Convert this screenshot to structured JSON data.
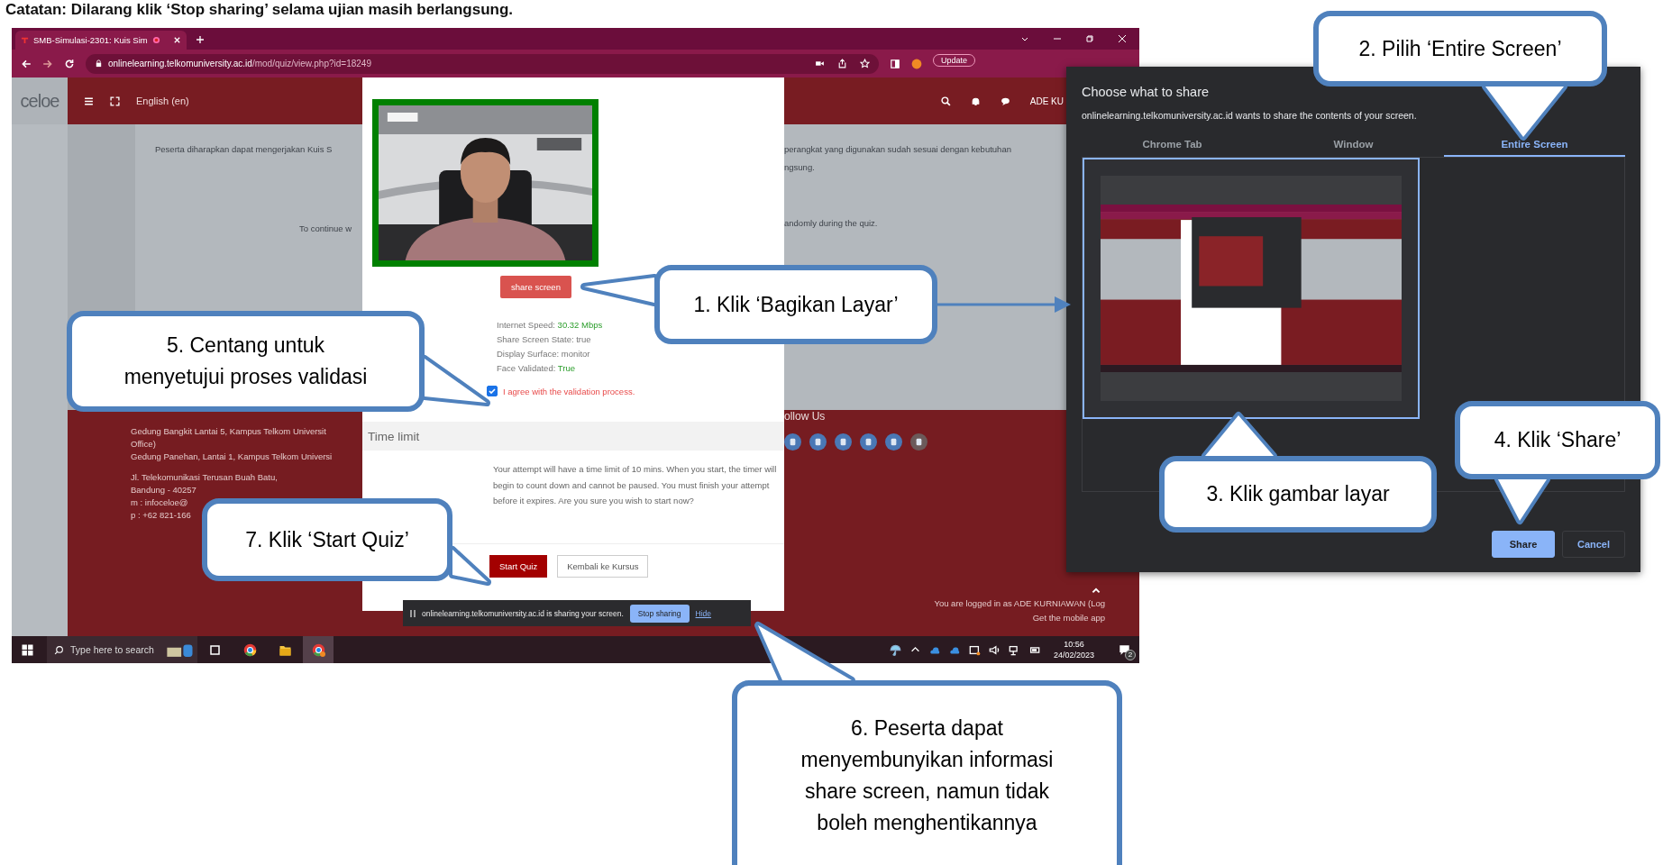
{
  "note": "Catatan: Dilarang klik ‘Stop sharing’ selama ujian masih berlangsung.",
  "browser": {
    "tab_title": "SMB-Simulasi-2301: Kuis Sim",
    "url_host": "onlinelearning.telkomuniversity.ac.id",
    "url_path": "/mod/quiz/view.php?id=18249",
    "update_button": "Update"
  },
  "site_header": {
    "logo": "celoe",
    "language": "English (en)",
    "user": "ADE KU"
  },
  "page_text": {
    "left": [
      "Peserta diharapkan dapat mengerjakan Kuis S",
      "To continue w"
    ],
    "right": [
      "perangkat yang digunakan sudah sesuai dengan kebutuhan",
      "ngsung.",
      "andomly during the quiz."
    ]
  },
  "footer": {
    "address": [
      [
        "Gedung Bangkit Lantai 5, Kampus Telkom Universit",
        "Office)",
        "Gedung Panehan, Lantai 1, Kampus Telkom Universi"
      ],
      [
        "Jl. Telekomunikasi Terusan Buah Batu,",
        "Bandung - 40257",
        "m : infoceloe@",
        "p : +62 821-166"
      ]
    ],
    "follow": "ollow Us",
    "logged_in": "You are logged in as ADE KURNIAWAN (Log",
    "mobile_app": "Get the mobile app"
  },
  "modal": {
    "share_button": "share screen",
    "status": [
      {
        "label": "Internet Speed:",
        "value": "30.32 Mbps",
        "highlighted": true
      },
      {
        "label": "Share Screen State:",
        "value": "true",
        "highlighted": false
      },
      {
        "label": "Display Surface:",
        "value": "monitor",
        "highlighted": false
      },
      {
        "label": "Face Validated:",
        "value": "True",
        "highlighted": true
      }
    ],
    "agree": {
      "label": "I agree with the validation process.",
      "checked": true
    },
    "time_limit": {
      "heading": "Time limit",
      "text": "Your attempt will have a time limit of 10 mins. When you start, the timer will begin to count down and cannot be paused. You must finish your attempt before it expires. Are you sure you wish to start now?"
    },
    "buttons": [
      {
        "label": "Start Quiz",
        "primary": true
      },
      {
        "label": "Kembali ke Kursus",
        "primary": false
      }
    ]
  },
  "sharing_bar": {
    "message": "onlinelearning.telkomuniversity.ac.id is sharing your screen.",
    "stop": "Stop sharing",
    "hide": "Hide"
  },
  "share_dialog": {
    "title": "Choose what to share",
    "subtitle": "onlinelearning.telkomuniversity.ac.id wants to share the contents of your screen.",
    "tabs": [
      {
        "label": "Chrome Tab",
        "selected": false
      },
      {
        "label": "Window",
        "selected": false
      },
      {
        "label": "Entire Screen",
        "selected": true
      }
    ],
    "buttons": [
      {
        "label": "Share",
        "primary": true
      },
      {
        "label": "Cancel",
        "primary": false
      }
    ]
  },
  "taskbar": {
    "search_placeholder": "Type here to search",
    "time": "10:56",
    "date": "24/02/2023",
    "notifications": "2"
  },
  "callouts": [
    {
      "lines": [
        "2. Pilih ‘Entire Screen’"
      ]
    },
    {
      "lines": [
        "1. Klik ‘Bagikan Layar’"
      ]
    },
    {
      "lines": [
        "5. Centang untuk",
        "menyetujui proses validasi"
      ]
    },
    {
      "lines": [
        "4. Klik ‘Share’"
      ]
    },
    {
      "lines": [
        "3. Klik gambar layar"
      ]
    },
    {
      "lines": [
        "7. Klik ‘Start Quiz’"
      ]
    },
    {
      "lines": [
        "6. Peserta dapat",
        "menyembunyikan informasi",
        "share screen, namun tidak",
        "boleh menghentikannya"
      ]
    }
  ]
}
